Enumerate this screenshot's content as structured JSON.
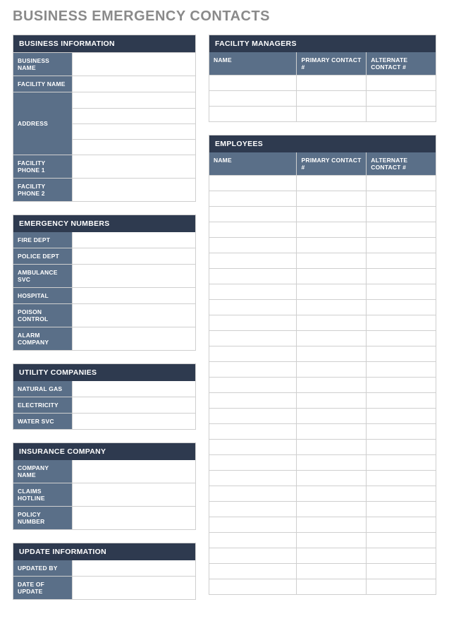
{
  "title": "BUSINESS EMERGENCY CONTACTS",
  "left": {
    "business_info": {
      "header": "BUSINESS INFORMATION",
      "rows": [
        {
          "label": "BUSINESS NAME",
          "value": ""
        },
        {
          "label": "FACILITY NAME",
          "value": ""
        }
      ],
      "address": {
        "label": "ADDRESS",
        "lines": [
          "",
          "",
          "",
          ""
        ]
      },
      "phones": [
        {
          "label": "FACILITY PHONE 1",
          "value": ""
        },
        {
          "label": "FACILITY PHONE 2",
          "value": ""
        }
      ]
    },
    "emergency_numbers": {
      "header": "EMERGENCY NUMBERS",
      "rows": [
        {
          "label": "FIRE DEPT",
          "value": ""
        },
        {
          "label": "POLICE DEPT",
          "value": ""
        },
        {
          "label": "AMBULANCE SVC",
          "value": ""
        },
        {
          "label": "HOSPITAL",
          "value": ""
        },
        {
          "label": "POISON CONTROL",
          "value": ""
        },
        {
          "label": "ALARM COMPANY",
          "value": ""
        }
      ]
    },
    "utility_companies": {
      "header": "UTILITY COMPANIES",
      "rows": [
        {
          "label": "NATURAL GAS",
          "value": ""
        },
        {
          "label": "ELECTRICITY",
          "value": ""
        },
        {
          "label": "WATER SVC",
          "value": ""
        }
      ]
    },
    "insurance_company": {
      "header": "INSURANCE COMPANY",
      "rows": [
        {
          "label": "COMPANY NAME",
          "value": ""
        },
        {
          "label": "CLAIMS HOTLINE",
          "value": ""
        },
        {
          "label": "POLICY NUMBER",
          "value": ""
        }
      ]
    },
    "update_information": {
      "header": "UPDATE INFORMATION",
      "rows": [
        {
          "label": "UPDATED BY",
          "value": ""
        },
        {
          "label": "DATE OF UPDATE",
          "value": ""
        }
      ]
    }
  },
  "right": {
    "facility_managers": {
      "header": "FACILITY MANAGERS",
      "columns": {
        "name": "NAME",
        "primary": "PRIMARY CONTACT #",
        "alternate": "ALTERNATE CONTACT #"
      },
      "rows": [
        {
          "name": "",
          "primary": "",
          "alternate": ""
        },
        {
          "name": "",
          "primary": "",
          "alternate": ""
        },
        {
          "name": "",
          "primary": "",
          "alternate": ""
        }
      ]
    },
    "employees": {
      "header": "EMPLOYEES",
      "columns": {
        "name": "NAME",
        "primary": "PRIMARY CONTACT #",
        "alternate": "ALTERNATE CONTACT #"
      },
      "rows": [
        {
          "name": "",
          "primary": "",
          "alternate": ""
        },
        {
          "name": "",
          "primary": "",
          "alternate": ""
        },
        {
          "name": "",
          "primary": "",
          "alternate": ""
        },
        {
          "name": "",
          "primary": "",
          "alternate": ""
        },
        {
          "name": "",
          "primary": "",
          "alternate": ""
        },
        {
          "name": "",
          "primary": "",
          "alternate": ""
        },
        {
          "name": "",
          "primary": "",
          "alternate": ""
        },
        {
          "name": "",
          "primary": "",
          "alternate": ""
        },
        {
          "name": "",
          "primary": "",
          "alternate": ""
        },
        {
          "name": "",
          "primary": "",
          "alternate": ""
        },
        {
          "name": "",
          "primary": "",
          "alternate": ""
        },
        {
          "name": "",
          "primary": "",
          "alternate": ""
        },
        {
          "name": "",
          "primary": "",
          "alternate": ""
        },
        {
          "name": "",
          "primary": "",
          "alternate": ""
        },
        {
          "name": "",
          "primary": "",
          "alternate": ""
        },
        {
          "name": "",
          "primary": "",
          "alternate": ""
        },
        {
          "name": "",
          "primary": "",
          "alternate": ""
        },
        {
          "name": "",
          "primary": "",
          "alternate": ""
        },
        {
          "name": "",
          "primary": "",
          "alternate": ""
        },
        {
          "name": "",
          "primary": "",
          "alternate": ""
        },
        {
          "name": "",
          "primary": "",
          "alternate": ""
        },
        {
          "name": "",
          "primary": "",
          "alternate": ""
        },
        {
          "name": "",
          "primary": "",
          "alternate": ""
        },
        {
          "name": "",
          "primary": "",
          "alternate": ""
        },
        {
          "name": "",
          "primary": "",
          "alternate": ""
        },
        {
          "name": "",
          "primary": "",
          "alternate": ""
        },
        {
          "name": "",
          "primary": "",
          "alternate": ""
        }
      ]
    }
  }
}
